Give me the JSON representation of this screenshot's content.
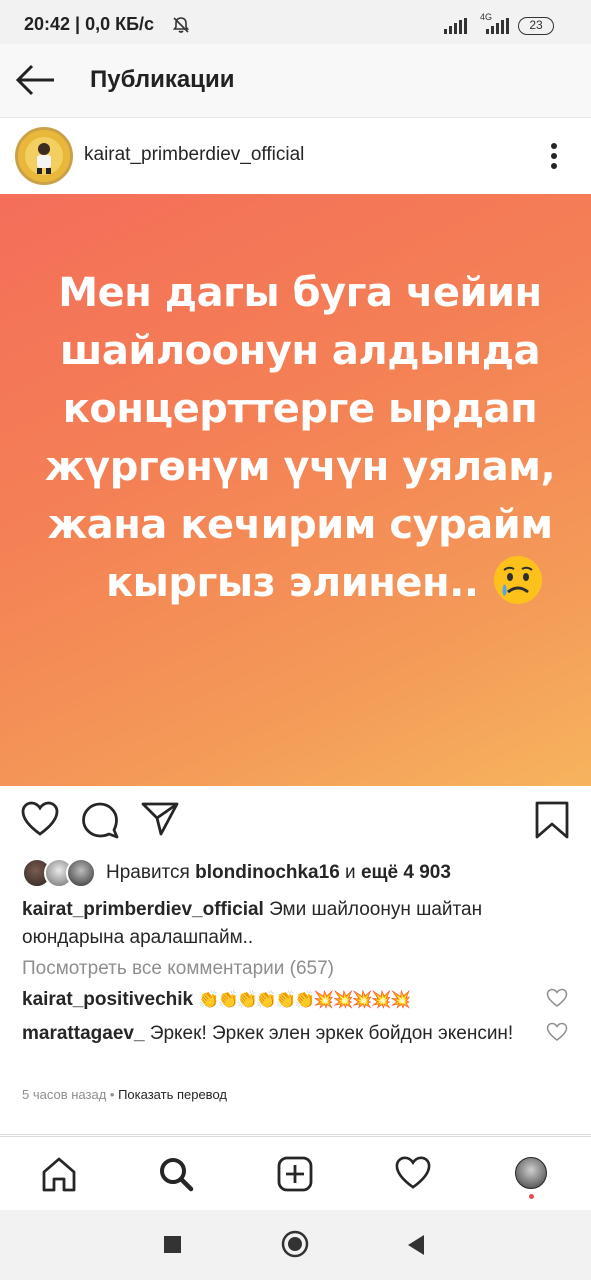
{
  "status_bar": {
    "time_and_speed": "20:42 | 0,0 КБ/с",
    "network": "4G",
    "battery": "23"
  },
  "app_bar": {
    "title": "Публикации"
  },
  "post": {
    "username": "kairat_primberdiev_official",
    "image_text_lines": [
      "Мен дагы буга чейин",
      "шайлоонун алдында",
      "концерттерге ырдап",
      "жүргөнүм үчүн уялам,",
      "жана кечирим сурайм",
      "кыргыз элинен.."
    ],
    "likes": {
      "prefix": "Нравится",
      "user": "blondinochka16",
      "middle": "и",
      "rest": "ещё 4 903"
    },
    "caption": {
      "user": "kairat_primberdiev_official",
      "text": "Эми шайлоонун шайтан оюндарына аралашпайм.."
    },
    "view_all_comments": "Посмотреть все комментарии (657)",
    "comments": [
      {
        "user": "kairat_positivechik",
        "text": "👏👏👏👏👏👏💥💥💥💥💥"
      },
      {
        "user": "marattagaev_",
        "text": "Эркек! Эркек элен эркек бойдон экенсин!"
      }
    ],
    "time_ago": "5 часов назад",
    "translate_link": "Показать перевод"
  },
  "colors": {
    "gradient_start": "#f46e5a",
    "gradient_end": "#f6b45e",
    "text_primary": "#262626",
    "text_secondary": "#8e8e8e"
  },
  "icons": [
    "back-arrow-icon",
    "more-vertical-icon",
    "heart-icon",
    "comment-icon",
    "share-icon",
    "bookmark-icon",
    "home-icon",
    "search-icon",
    "add-icon",
    "activity-icon",
    "profile-avatar"
  ]
}
